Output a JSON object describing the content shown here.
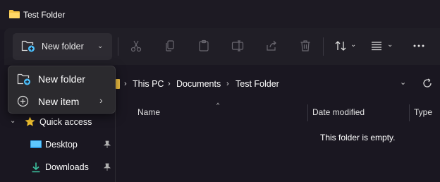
{
  "window": {
    "title": "Test Folder"
  },
  "toolbar": {
    "new_folder_label": "New folder",
    "icons": [
      "cut-icon",
      "copy-icon",
      "paste-icon",
      "rename-icon",
      "share-icon",
      "delete-icon",
      "sort-icon",
      "view-icon",
      "more-icon"
    ]
  },
  "address": {
    "crumbs": [
      "This PC",
      "Documents",
      "Test Folder"
    ]
  },
  "menu": {
    "items": [
      {
        "label": "New folder",
        "icon": "new-folder-icon"
      },
      {
        "label": "New item",
        "icon": "new-item-icon",
        "has_submenu": true
      }
    ]
  },
  "sidebar": {
    "items": [
      {
        "label": "Quick access",
        "icon": "star-icon"
      },
      {
        "label": "Desktop",
        "icon": "desktop-icon",
        "pinned": true
      },
      {
        "label": "Downloads",
        "icon": "download-icon",
        "pinned": true
      }
    ]
  },
  "columns": [
    "Name",
    "Date modified",
    "Type"
  ],
  "content": {
    "empty_message": "This folder is empty."
  },
  "colors": {
    "accent_folder": "#f5c445",
    "accent_blue": "#4cc2ff",
    "star": "#f4c430"
  }
}
